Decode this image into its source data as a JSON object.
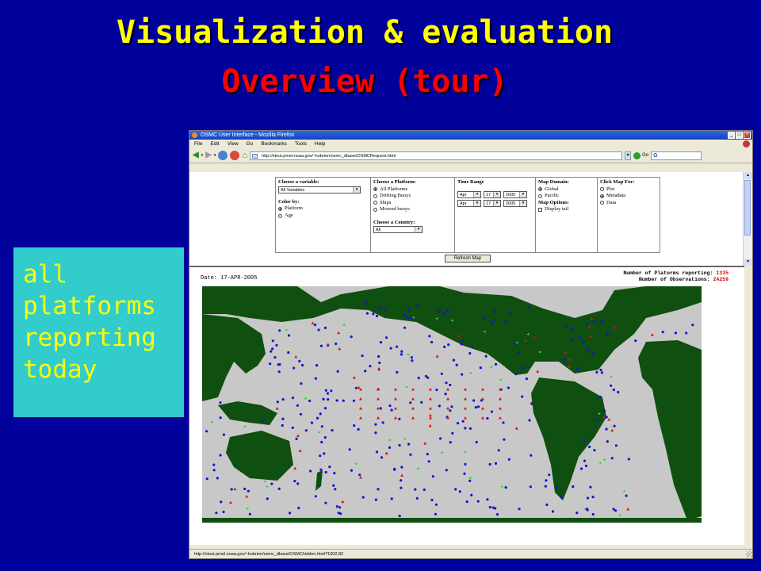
{
  "slide": {
    "title": "Visualization & evaluation",
    "subtitle": "Overview (tour)",
    "callout_lines": [
      "all",
      "platforms",
      "reporting",
      "today"
    ]
  },
  "browser": {
    "window_title": "OSMC User Interface - Mozilla Firefox",
    "menu": [
      "File",
      "Edit",
      "View",
      "Go",
      "Bookmarks",
      "Tools",
      "Help"
    ],
    "url": "http://stout.pmel.noaa.gov/~kobrien/osmc_dbase/OSMCRequest.html",
    "go_label": "Go",
    "search_placeholder": "G",
    "status_url": "http://stout.pmel.noaa.gov/~kobrien/osmc_dbase/OSMChidden.html?1002,82"
  },
  "form": {
    "variable": {
      "heading": "Choose a variable:",
      "selected": "All Variables"
    },
    "color_by": {
      "heading": "Color by:",
      "options": [
        "Platform",
        "Age"
      ],
      "selected_index": 0
    },
    "platform": {
      "heading": "Choose a Platform:",
      "options": [
        "All Platforms",
        "Drifting Buoys",
        "Ships",
        "Moored buoys"
      ],
      "selected_index": 0
    },
    "country": {
      "heading": "Choose a Country:",
      "selected": "All"
    },
    "time_range": {
      "heading": "Time Range",
      "start": {
        "month": "Apr",
        "day": "17",
        "year": "2005"
      },
      "end": {
        "month": "Apr",
        "day": "17",
        "year": "2005"
      }
    },
    "map_domain": {
      "heading": "Map Domain:",
      "options": [
        "Global",
        "Pacific"
      ],
      "selected_index": 0
    },
    "map_options": {
      "heading": "Map Options:",
      "display_tail_label": "Display tail",
      "display_tail_checked": false
    },
    "click_map": {
      "heading": "Click Map For:",
      "options": [
        "Plot",
        "Metadata",
        "Data"
      ],
      "selected_index": 1
    },
    "refresh_label": "Refresh Map"
  },
  "map": {
    "date_label": "Date: 17-APR-2005",
    "platforms_label": "Number of Platorms reporting:",
    "platforms_value": "1335",
    "observations_label": "Number of Observations:",
    "observations_value": "24259",
    "colors": {
      "land": "#0f4f0f",
      "ocean": "#c8c8c8",
      "drifter": "#1414d2",
      "ship": "#22dd22",
      "moored": "#e01010"
    }
  },
  "colors": {
    "slide_bg": "#00009a",
    "title": "#ffff00",
    "subtitle": "#ff0000",
    "callout_bg": "#33cccc"
  }
}
